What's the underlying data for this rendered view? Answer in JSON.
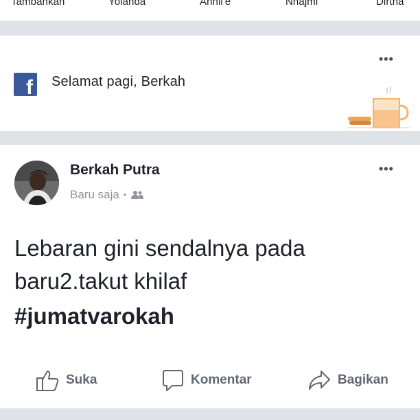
{
  "stories": [
    "Tambahkan",
    "Yolanda",
    "Annil'e",
    "Nhajmi",
    "Dirtha"
  ],
  "greeting": {
    "brand_icon": "facebook-logo-icon",
    "text": "Selamat pagi, Berkah",
    "more_icon": "more-dots-icon",
    "illustration_icon": "coffee-cup-icon"
  },
  "post": {
    "author": "Berkah Putra",
    "time": "Baru saja",
    "separator": "•",
    "audience_icon": "friends-icon",
    "text_line1": "Lebaran gini sendalnya pada",
    "text_line2": "baru2.takut khilaf",
    "hashtag": "#jumatvarokah",
    "more_icon": "more-dots-icon"
  },
  "actions": {
    "like_label": "Suka",
    "comment_label": "Komentar",
    "share_label": "Bagikan"
  },
  "colors": {
    "brand": "#3b5998",
    "divider": "#dfe3e8",
    "muted": "#90949c",
    "action": "#606770"
  }
}
